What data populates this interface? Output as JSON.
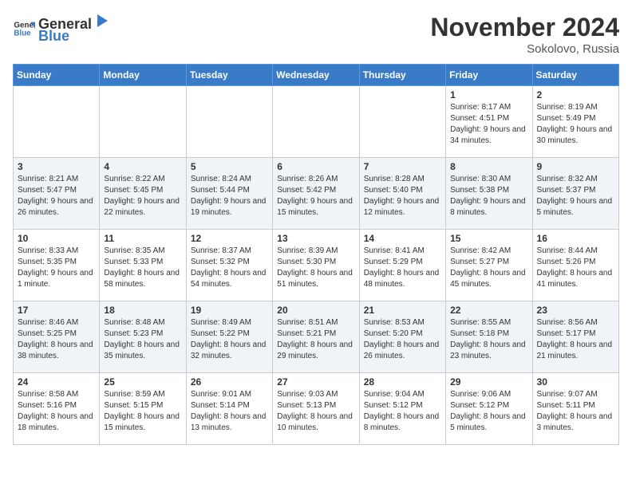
{
  "header": {
    "logo_general": "General",
    "logo_blue": "Blue",
    "month": "November 2024",
    "location": "Sokolovo, Russia"
  },
  "days_of_week": [
    "Sunday",
    "Monday",
    "Tuesday",
    "Wednesday",
    "Thursday",
    "Friday",
    "Saturday"
  ],
  "weeks": [
    [
      {
        "day": "",
        "info": ""
      },
      {
        "day": "",
        "info": ""
      },
      {
        "day": "",
        "info": ""
      },
      {
        "day": "",
        "info": ""
      },
      {
        "day": "",
        "info": ""
      },
      {
        "day": "1",
        "info": "Sunrise: 8:17 AM\nSunset: 4:51 PM\nDaylight: 9 hours and 34 minutes."
      },
      {
        "day": "2",
        "info": "Sunrise: 8:19 AM\nSunset: 5:49 PM\nDaylight: 9 hours and 30 minutes."
      }
    ],
    [
      {
        "day": "3",
        "info": "Sunrise: 8:21 AM\nSunset: 5:47 PM\nDaylight: 9 hours and 26 minutes."
      },
      {
        "day": "4",
        "info": "Sunrise: 8:22 AM\nSunset: 5:45 PM\nDaylight: 9 hours and 22 minutes."
      },
      {
        "day": "5",
        "info": "Sunrise: 8:24 AM\nSunset: 5:44 PM\nDaylight: 9 hours and 19 minutes."
      },
      {
        "day": "6",
        "info": "Sunrise: 8:26 AM\nSunset: 5:42 PM\nDaylight: 9 hours and 15 minutes."
      },
      {
        "day": "7",
        "info": "Sunrise: 8:28 AM\nSunset: 5:40 PM\nDaylight: 9 hours and 12 minutes."
      },
      {
        "day": "8",
        "info": "Sunrise: 8:30 AM\nSunset: 5:38 PM\nDaylight: 9 hours and 8 minutes."
      },
      {
        "day": "9",
        "info": "Sunrise: 8:32 AM\nSunset: 5:37 PM\nDaylight: 9 hours and 5 minutes."
      }
    ],
    [
      {
        "day": "10",
        "info": "Sunrise: 8:33 AM\nSunset: 5:35 PM\nDaylight: 9 hours and 1 minute."
      },
      {
        "day": "11",
        "info": "Sunrise: 8:35 AM\nSunset: 5:33 PM\nDaylight: 8 hours and 58 minutes."
      },
      {
        "day": "12",
        "info": "Sunrise: 8:37 AM\nSunset: 5:32 PM\nDaylight: 8 hours and 54 minutes."
      },
      {
        "day": "13",
        "info": "Sunrise: 8:39 AM\nSunset: 5:30 PM\nDaylight: 8 hours and 51 minutes."
      },
      {
        "day": "14",
        "info": "Sunrise: 8:41 AM\nSunset: 5:29 PM\nDaylight: 8 hours and 48 minutes."
      },
      {
        "day": "15",
        "info": "Sunrise: 8:42 AM\nSunset: 5:27 PM\nDaylight: 8 hours and 45 minutes."
      },
      {
        "day": "16",
        "info": "Sunrise: 8:44 AM\nSunset: 5:26 PM\nDaylight: 8 hours and 41 minutes."
      }
    ],
    [
      {
        "day": "17",
        "info": "Sunrise: 8:46 AM\nSunset: 5:25 PM\nDaylight: 8 hours and 38 minutes."
      },
      {
        "day": "18",
        "info": "Sunrise: 8:48 AM\nSunset: 5:23 PM\nDaylight: 8 hours and 35 minutes."
      },
      {
        "day": "19",
        "info": "Sunrise: 8:49 AM\nSunset: 5:22 PM\nDaylight: 8 hours and 32 minutes."
      },
      {
        "day": "20",
        "info": "Sunrise: 8:51 AM\nSunset: 5:21 PM\nDaylight: 8 hours and 29 minutes."
      },
      {
        "day": "21",
        "info": "Sunrise: 8:53 AM\nSunset: 5:20 PM\nDaylight: 8 hours and 26 minutes."
      },
      {
        "day": "22",
        "info": "Sunrise: 8:55 AM\nSunset: 5:18 PM\nDaylight: 8 hours and 23 minutes."
      },
      {
        "day": "23",
        "info": "Sunrise: 8:56 AM\nSunset: 5:17 PM\nDaylight: 8 hours and 21 minutes."
      }
    ],
    [
      {
        "day": "24",
        "info": "Sunrise: 8:58 AM\nSunset: 5:16 PM\nDaylight: 8 hours and 18 minutes."
      },
      {
        "day": "25",
        "info": "Sunrise: 8:59 AM\nSunset: 5:15 PM\nDaylight: 8 hours and 15 minutes."
      },
      {
        "day": "26",
        "info": "Sunrise: 9:01 AM\nSunset: 5:14 PM\nDaylight: 8 hours and 13 minutes."
      },
      {
        "day": "27",
        "info": "Sunrise: 9:03 AM\nSunset: 5:13 PM\nDaylight: 8 hours and 10 minutes."
      },
      {
        "day": "28",
        "info": "Sunrise: 9:04 AM\nSunset: 5:12 PM\nDaylight: 8 hours and 8 minutes."
      },
      {
        "day": "29",
        "info": "Sunrise: 9:06 AM\nSunset: 5:12 PM\nDaylight: 8 hours and 5 minutes."
      },
      {
        "day": "30",
        "info": "Sunrise: 9:07 AM\nSunset: 5:11 PM\nDaylight: 8 hours and 3 minutes."
      }
    ]
  ]
}
